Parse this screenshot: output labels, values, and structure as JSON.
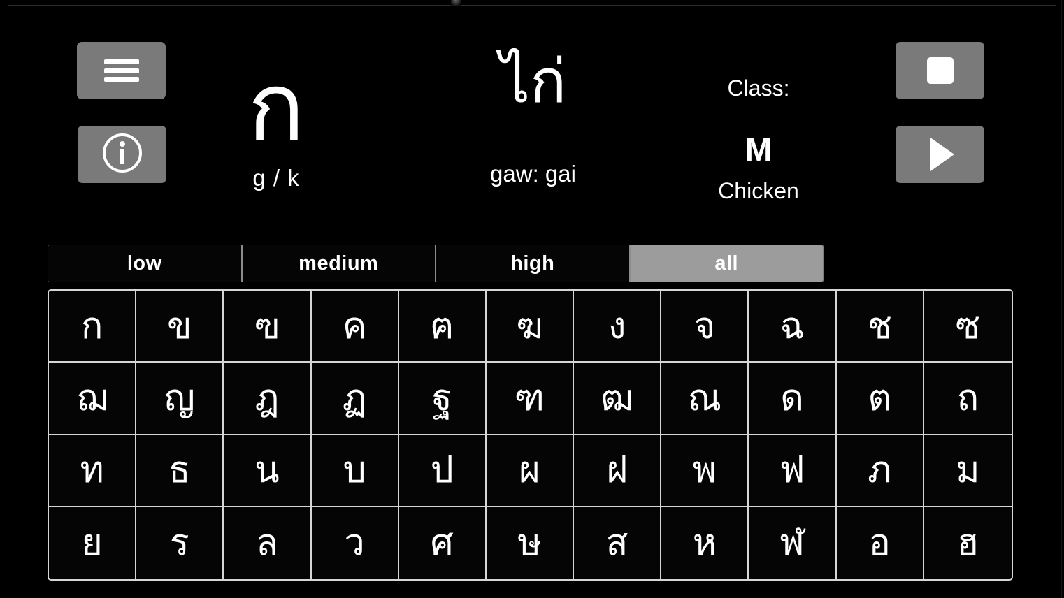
{
  "theme": {
    "background": "#000000",
    "text": "#ffffff",
    "button_gray": "#7a7a7a",
    "selected_tab": "#9c9c9c",
    "grid_border": "#d6d6d6"
  },
  "header": {
    "menu_button": {
      "icon": "hamburger-menu-icon"
    },
    "info_button": {
      "icon": "info-circle-icon"
    },
    "stop_button": {
      "icon": "stop-square-icon"
    },
    "play_button": {
      "icon": "play-triangle-icon"
    },
    "letter": {
      "glyph": "ก",
      "sound": "g / k"
    },
    "word": {
      "thai": "ไก่",
      "romanization": "gaw: gai"
    },
    "class": {
      "label": "Class:",
      "value": "M",
      "meaning": "Chicken"
    }
  },
  "tabs": [
    {
      "label": "low",
      "selected": false
    },
    {
      "label": "medium",
      "selected": false
    },
    {
      "label": "high",
      "selected": false
    },
    {
      "label": "all",
      "selected": true
    }
  ],
  "grid": {
    "columns": 11,
    "rows": 4,
    "letters": [
      "ก",
      "ข",
      "ฃ",
      "ค",
      "ฅ",
      "ฆ",
      "ง",
      "จ",
      "ฉ",
      "ช",
      "ซ",
      "ฌ",
      "ญ",
      "ฎ",
      "ฏ",
      "ฐ",
      "ฑ",
      "ฒ",
      "ณ",
      "ด",
      "ต",
      "ถ",
      "ท",
      "ธ",
      "น",
      "บ",
      "ป",
      "ผ",
      "ฝ",
      "พ",
      "ฟ",
      "ภ",
      "ม",
      "ย",
      "ร",
      "ล",
      "ว",
      "ศ",
      "ษ",
      "ส",
      "ห",
      "ฬ",
      "อ",
      "ฮ"
    ]
  }
}
